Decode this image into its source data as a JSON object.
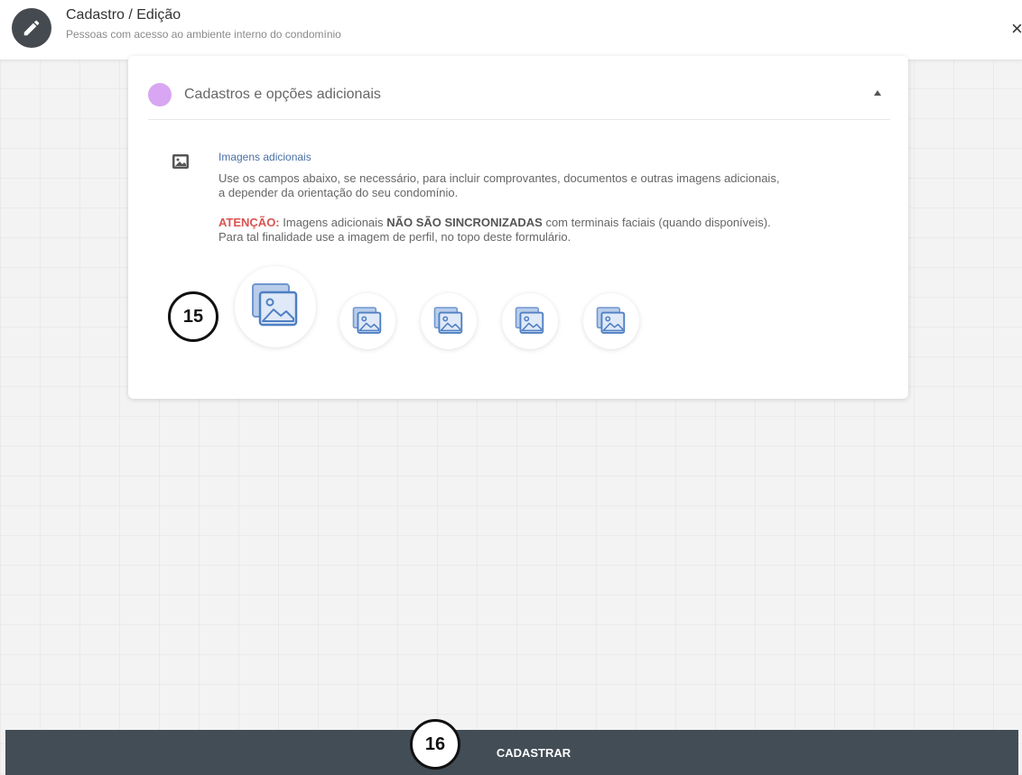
{
  "header": {
    "icon": "pencil-icon",
    "title": "Cadastro / Edição",
    "subtitle": "Pessoas com acesso ao ambiente interno do condomínio",
    "close_label": "×"
  },
  "section": {
    "title": "Cadastros e opções adicionais",
    "dot_color": "#d8a6f2",
    "expanded": true
  },
  "images_block": {
    "icon": "image-icon",
    "title": "Imagens adicionais",
    "desc_line1": "Use os campos abaixo, se necessário, para incluir comprovantes, documentos e outras imagens adicionais,",
    "desc_line2": "a depender da orientação do seu condomínio.",
    "warning_label": "ATENÇÃO:",
    "warning_text1": "Imagens adicionais",
    "warning_strong": "NÃO SÃO SINCRONIZADAS",
    "warning_text2": "com terminais faciais (quando disponíveis).",
    "warning_line2": "Para tal finalidade use a imagem de perfil, no topo deste formulário.",
    "upload_slots": 5
  },
  "callouts": [
    "15",
    "16"
  ],
  "footer": {
    "submit_label": "CADASTRAR",
    "bar_color": "#434d56"
  }
}
